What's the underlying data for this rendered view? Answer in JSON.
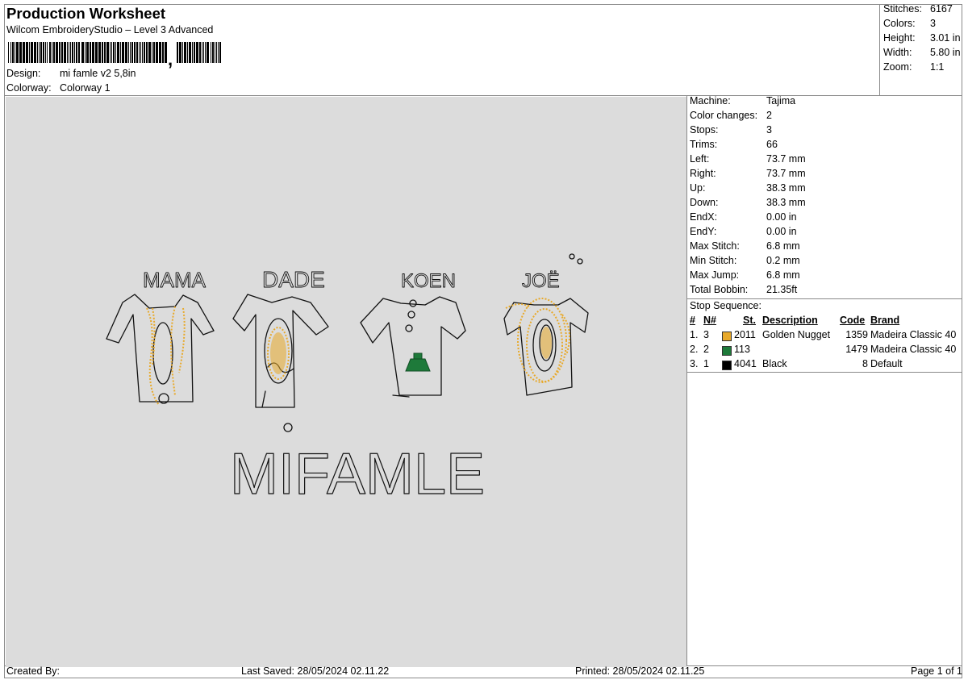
{
  "header": {
    "title": "Production Worksheet",
    "software": "Wilcom EmbroideryStudio – Level 3 Advanced",
    "design_label": "Design:",
    "design_value": "mi famle v2 5,8in",
    "colorway_label": "Colorway:",
    "colorway_value": "Colorway 1",
    "barcode_separator": ","
  },
  "stats": [
    {
      "label": "Stitches:",
      "value": "6167"
    },
    {
      "label": "Colors:",
      "value": "3"
    },
    {
      "label": "Height:",
      "value": "3.01 in"
    },
    {
      "label": "Width:",
      "value": "5.80 in"
    },
    {
      "label": "Zoom:",
      "value": "1:1"
    }
  ],
  "machine": [
    {
      "label": "Machine:",
      "value": "Tajima"
    },
    {
      "label": "Color changes:",
      "value": "2"
    },
    {
      "label": "Stops:",
      "value": "3"
    },
    {
      "label": "Trims:",
      "value": "66"
    },
    {
      "label": "Left:",
      "value": "73.7 mm"
    },
    {
      "label": "Right:",
      "value": "73.7 mm"
    },
    {
      "label": "Up:",
      "value": "38.3 mm"
    },
    {
      "label": "Down:",
      "value": "38.3 mm"
    },
    {
      "label": "EndX:",
      "value": "0.00 in"
    },
    {
      "label": "EndY:",
      "value": "0.00 in"
    },
    {
      "label": "Max Stitch:",
      "value": "6.8 mm"
    },
    {
      "label": "Min Stitch:",
      "value": "0.2 mm"
    },
    {
      "label": "Max Jump:",
      "value": "6.8 mm"
    },
    {
      "label": "Total Bobbin:",
      "value": "21.35ft"
    }
  ],
  "stop_sequence": {
    "title": "Stop Sequence:",
    "columns": {
      "num": "#",
      "n": "N#",
      "st": "St.",
      "description": "Description",
      "code": "Code",
      "brand": "Brand"
    },
    "rows": [
      {
        "num": "1.",
        "n": "3",
        "color": "#E8A92A",
        "st": "2011",
        "description": "Golden Nugget",
        "code": "1359",
        "brand": "Madeira Classic 40"
      },
      {
        "num": "2.",
        "n": "2",
        "color": "#1E7A3A",
        "st": "113",
        "description": "",
        "code": "1479",
        "brand": "Madeira Classic 40"
      },
      {
        "num": "3.",
        "n": "1",
        "color": "#000000",
        "st": "4041",
        "description": "Black",
        "code": "8",
        "brand": "Default"
      }
    ]
  },
  "footer": {
    "created_by": "Created By:",
    "last_saved": "Last Saved: 28/05/2024 02.11.22",
    "printed": "Printed: 28/05/2024 02.11.25",
    "page": "Page 1 of 1"
  },
  "design_text": {
    "names": [
      "MAMA",
      "DADE",
      "KOEN",
      "JOË"
    ],
    "caption": "MIFAMLE"
  },
  "colors": {
    "canvas_bg": "#dcdcdc",
    "gold": "#E8A92A",
    "green": "#1E7A3A",
    "outline": "#111111"
  }
}
